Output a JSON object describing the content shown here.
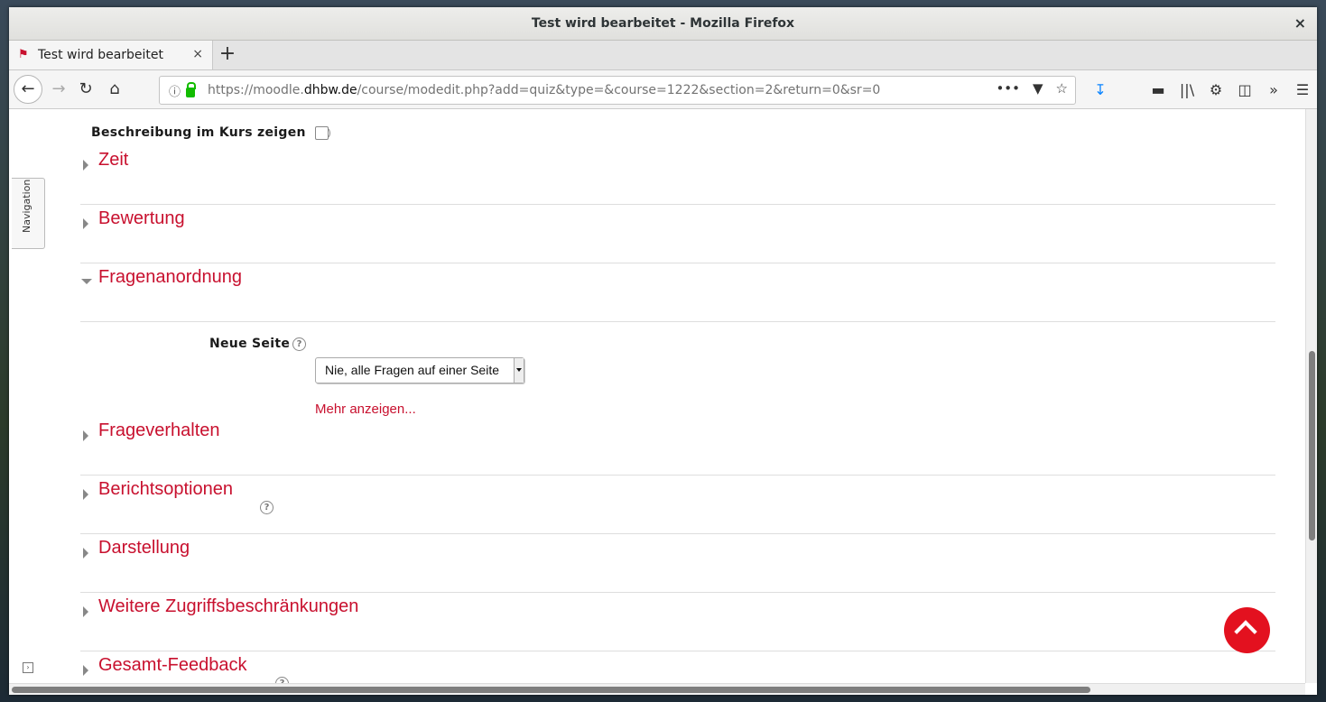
{
  "window": {
    "title": "Test wird bearbeitet - Mozilla Firefox",
    "close": "×"
  },
  "tab": {
    "title": "Test wird bearbeitet",
    "close": "×",
    "new_tab": "+"
  },
  "navbar": {
    "url_prefix": "https://moodle.",
    "url_host": "dhbw.de",
    "url_path": "/course/modedit.php?add=quiz&type=&course=1222&section=2&return=0&sr=0"
  },
  "side": {
    "navigation_label": "Navigation"
  },
  "form": {
    "description_label": "Beschreibung im Kurs zeigen",
    "neue_seite_label": "Neue Seite",
    "neue_seite_value": "Nie, alle Fragen auf einer Seite",
    "mehr_anzeigen": "Mehr anzeigen..."
  },
  "sections": [
    {
      "title": "Zeit",
      "expanded": false,
      "help": false
    },
    {
      "title": "Bewertung",
      "expanded": false,
      "help": false
    },
    {
      "title": "Fragenanordnung",
      "expanded": true,
      "help": false
    },
    {
      "title": "Frageverhalten",
      "expanded": false,
      "help": false
    },
    {
      "title": "Berichtsoptionen",
      "expanded": false,
      "help": true
    },
    {
      "title": "Darstellung",
      "expanded": false,
      "help": false
    },
    {
      "title": "Weitere Zugriffsbeschränkungen",
      "expanded": false,
      "help": false
    },
    {
      "title": "Gesamt-Feedback",
      "expanded": false,
      "help": true
    }
  ],
  "colors": {
    "accent": "#c8102e",
    "totop": "#e3111f"
  }
}
